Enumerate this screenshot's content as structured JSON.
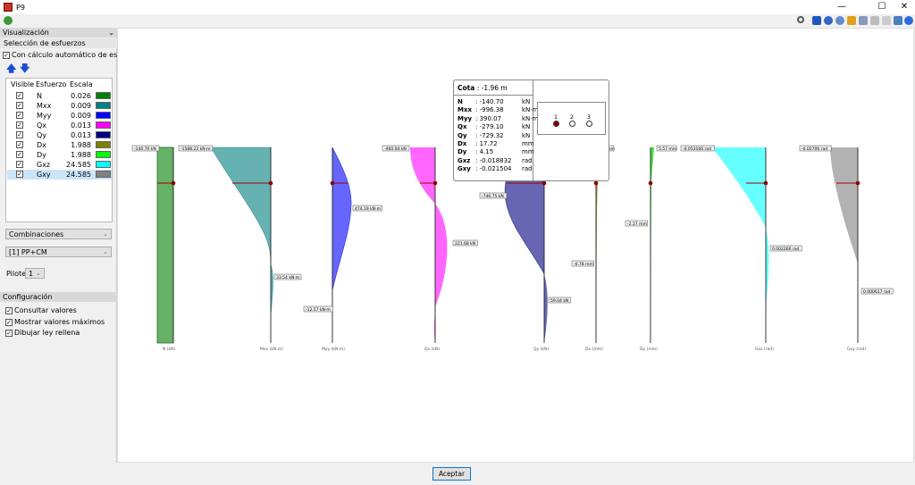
{
  "window": {
    "title": "P9",
    "minimize": "—",
    "maximize": "☐",
    "close": "✕"
  },
  "toolbar": {
    "icons": [
      "zoom-icon",
      "zoom-previous-icon",
      "zoom-all-icon",
      "zoom-window-icon",
      "rotate-icon",
      "zoom-in-icon",
      "pan-icon",
      "move-icon",
      "view-icon",
      "help-icon"
    ]
  },
  "sidebar": {
    "visualizacion": "Visualización",
    "seleccion": "Selección de esfuerzos",
    "auto_scale": "Con cálculo automático de escalas",
    "table_headers": [
      "Visible",
      "Esfuerzo",
      "Escala"
    ],
    "rows": [
      {
        "name": "N",
        "scale": "0.026",
        "color": "#008000"
      },
      {
        "name": "Mxx",
        "scale": "0.009",
        "color": "#008080"
      },
      {
        "name": "Myy",
        "scale": "0.009",
        "color": "#0000ff"
      },
      {
        "name": "Qx",
        "scale": "0.013",
        "color": "#ff00ff"
      },
      {
        "name": "Qy",
        "scale": "0.013",
        "color": "#000080"
      },
      {
        "name": "Dx",
        "scale": "1.988",
        "color": "#808000"
      },
      {
        "name": "Dy",
        "scale": "1.988",
        "color": "#00ff00"
      },
      {
        "name": "Gxz",
        "scale": "24.585",
        "color": "#00ffff"
      },
      {
        "name": "Gxy",
        "scale": "24.585",
        "color": "#808080"
      }
    ],
    "combo_type": "Combinaciones",
    "combo_value": "[1] PP+CM",
    "pilote_label": "Pilote",
    "pilote_value": "1",
    "configuracion": "Configuración",
    "options": [
      "Consultar valores",
      "Mostrar valores máximos",
      "Dibujar ley rellena"
    ]
  },
  "diagrams": [
    {
      "axis": "N (kN)",
      "labels": [
        "-140.70 kN"
      ]
    },
    {
      "axis": "Mxx (kN·m)",
      "labels": [
        "-1588.23 kN·m",
        "33.54 kN·m"
      ]
    },
    {
      "axis": "Myy (kN·m)",
      "labels": [
        "474.19 kN·m",
        "-12.57 kN·m"
      ]
    },
    {
      "axis": "Qx (kN)",
      "labels": [
        "-460.04 kN",
        "221.68 kN"
      ]
    },
    {
      "axis": "Qy (kN)",
      "labels": [
        "-746.75 kN",
        "59.04 kN"
      ]
    },
    {
      "axis": "Dx (mm)",
      "labels": [
        "23 mm",
        "-0.78 mm"
      ]
    },
    {
      "axis": "Dy (mm)",
      "labels": [
        "5.57 mm",
        "-2.17 mm"
      ]
    },
    {
      "axis": "Gxz (rad)",
      "labels": [
        "-0.053166 rad",
        "0.002266 rad"
      ]
    },
    {
      "axis": "Gxy (rad)",
      "labels": [
        "-0.02706 rad",
        "0.000617 rad"
      ]
    }
  ],
  "tooltip": {
    "cota_label": "Cota",
    "cota_value": ": -1.96 m",
    "values": [
      {
        "k": "N",
        "v": ": -140.70",
        "u": "kN"
      },
      {
        "k": "Mxx",
        "v": ": -996.38",
        "u": "kN·m"
      },
      {
        "k": "Myy",
        "v": ": 390.07",
        "u": "kN·m"
      },
      {
        "k": "Qx",
        "v": ": -279.10",
        "u": "kN"
      },
      {
        "k": "Qy",
        "v": ": -729.32",
        "u": "kN"
      },
      {
        "k": "Dx",
        "v": ": 17.72",
        "u": "mm"
      },
      {
        "k": "Dy",
        "v": ": 4.15",
        "u": "mm"
      },
      {
        "k": "Gxz",
        "v": ": -0.018832",
        "u": "rad"
      },
      {
        "k": "Gxy",
        "v": ": -0.021504",
        "u": "rad"
      }
    ],
    "piles": [
      "1",
      "2",
      "3"
    ],
    "selected_pile": "1"
  },
  "footer": {
    "accept": "Aceptar"
  }
}
